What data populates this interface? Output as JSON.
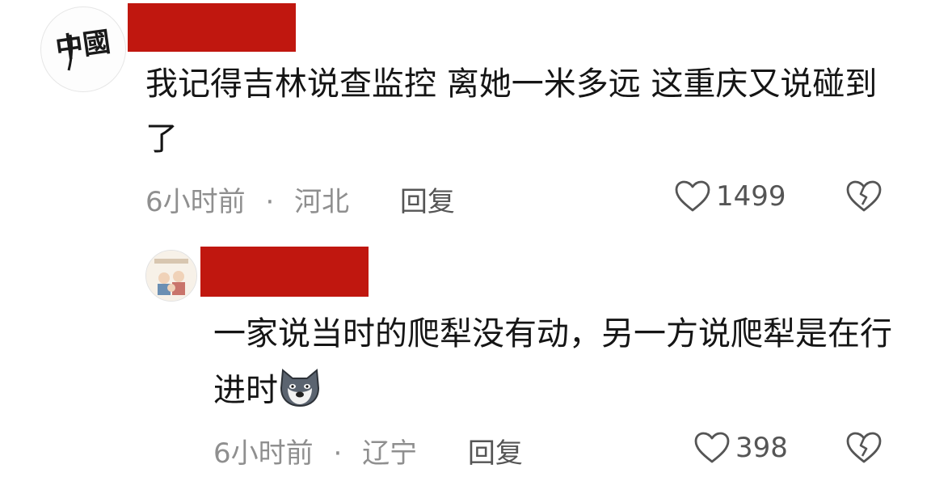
{
  "comments": [
    {
      "text": "我记得吉林说查监控  离她一米多远  这重庆又说碰到了",
      "time": "6小时前",
      "separator": "·",
      "location": "河北",
      "reply_label": "回复",
      "likes": "1499",
      "avatar_glyph": "中國",
      "icons": {
        "like": "heart-outline-icon",
        "dislike": "broken-heart-icon"
      }
    },
    {
      "text": "一家说当时的爬犁没有动，另一方说爬犁是在行进时",
      "time": "6小时前",
      "separator": "·",
      "location": "辽宁",
      "reply_label": "回复",
      "likes": "398",
      "emoji": "dog-face-emoji",
      "icons": {
        "like": "heart-outline-icon",
        "dislike": "broken-heart-icon"
      }
    }
  ],
  "colors": {
    "redaction": "#c0170f",
    "meta_text": "#8f8f8f",
    "body_text": "#151515"
  }
}
